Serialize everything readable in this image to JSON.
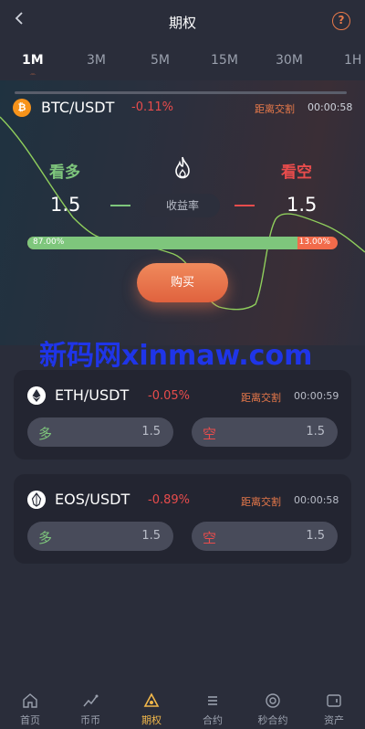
{
  "header": {
    "title": "期权",
    "help": "?"
  },
  "timeframes": [
    "1M",
    "3M",
    "5M",
    "15M",
    "30M",
    "1H"
  ],
  "active_timeframe": "1M",
  "main": {
    "coin_symbol": "₿",
    "pair": "BTC/USDT",
    "change": "-0.11%",
    "settle_label": "距离交割",
    "settle_time": "00:00:58",
    "bull_label": "看多",
    "bear_label": "看空",
    "bull_value": "1.5",
    "bear_value": "1.5",
    "rate_label": "收益率",
    "long_ratio_label": "87.00%",
    "short_ratio_label": "13.00%",
    "long_ratio": 0.87,
    "buy_label": "购买"
  },
  "watermark": "新码网xinmaw.com",
  "cards": [
    {
      "pair": "ETH/USDT",
      "change": "-0.05%",
      "settle_label": "距离交割",
      "settle_time": "00:00:59",
      "long_label": "多",
      "long_value": "1.5",
      "short_label": "空",
      "short_value": "1.5"
    },
    {
      "pair": "EOS/USDT",
      "change": "-0.89%",
      "settle_label": "距离交割",
      "settle_time": "00:00:58",
      "long_label": "多",
      "long_value": "1.5",
      "short_label": "空",
      "short_value": "1.5"
    }
  ],
  "tabs": [
    "首页",
    "币币",
    "期权",
    "合约",
    "秒合约",
    "资产"
  ],
  "active_tab": "期权",
  "colors": {
    "bull": "#7ec67c",
    "bear": "#e84c4c",
    "accent": "#e8794a",
    "active_tab": "#f2b84b"
  }
}
